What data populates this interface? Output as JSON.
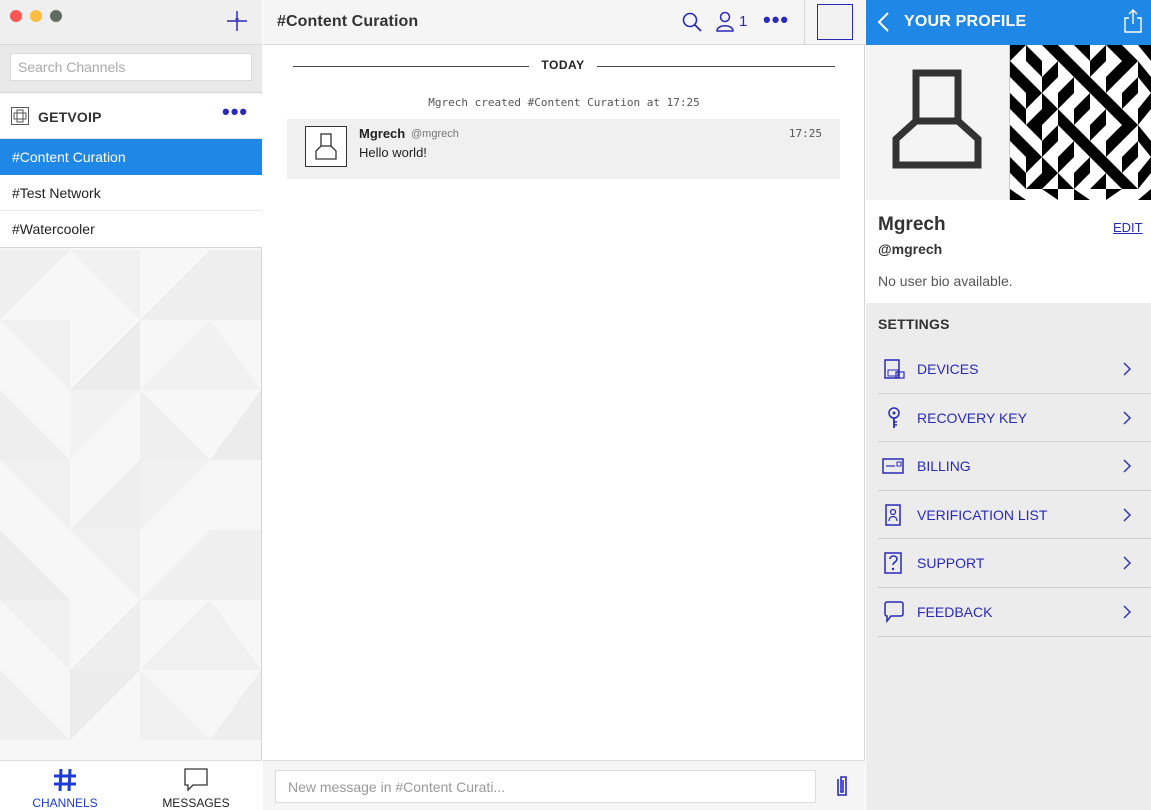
{
  "colors": {
    "accent": "#1f87e5",
    "link": "#2a2ab8",
    "active_channel_bg": "#1f87e5"
  },
  "sidebar": {
    "search_placeholder": "Search Channels",
    "team_name": "GETVOIP",
    "team_more": "•••",
    "channels": [
      {
        "label": "#Content Curation",
        "active": true
      },
      {
        "label": "#Test Network",
        "active": false
      },
      {
        "label": "#Watercooler",
        "active": false
      }
    ],
    "nav": {
      "channels_label": "CHANNELS",
      "messages_label": "MESSAGES"
    }
  },
  "chat": {
    "title": "#Content Curation",
    "member_count": "1",
    "more": "•••",
    "day_label": "TODAY",
    "system_message": "Mgrech created #Content Curation at 17:25",
    "messages": [
      {
        "author": "Mgrech",
        "handle": "@mgrech",
        "text": "Hello world!",
        "time": "17:25"
      }
    ],
    "composer_placeholder": "New message in #Content Curati..."
  },
  "profile": {
    "title": "YOUR PROFILE",
    "name": "Mgrech",
    "handle": "@mgrech",
    "edit_label": "EDIT",
    "bio": "No user bio available.",
    "settings_title": "SETTINGS",
    "settings": [
      {
        "label": "DEVICES",
        "icon": "device-icon"
      },
      {
        "label": "RECOVERY KEY",
        "icon": "key-icon"
      },
      {
        "label": "BILLING",
        "icon": "credit-card-icon"
      },
      {
        "label": "VERIFICATION LIST",
        "icon": "verification-badge-icon"
      },
      {
        "label": "SUPPORT",
        "icon": "help-icon"
      },
      {
        "label": "FEEDBACK",
        "icon": "speech-bubble-icon"
      }
    ]
  }
}
